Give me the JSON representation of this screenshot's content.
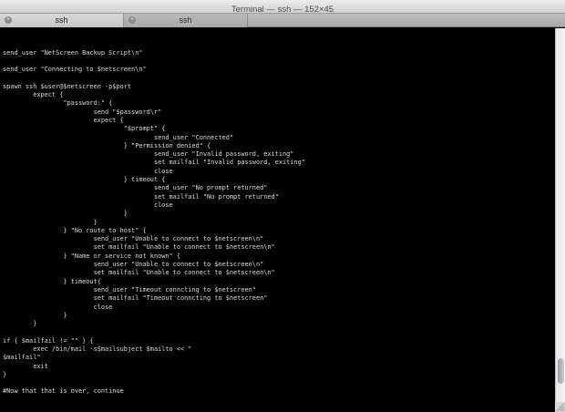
{
  "window": {
    "title": "Terminal — ssh — 152×45"
  },
  "tabs": [
    {
      "label": "ssh",
      "active": true
    },
    {
      "label": "ssh",
      "active": false
    }
  ],
  "terminal": {
    "lines": [
      "",
      "",
      "send_user \"NetScreen Backup Script\\n\"",
      "",
      "send_user \"Connecting to $netscreen\\n\"",
      "",
      "spawn ssh $user@$netscreen -p$port",
      "        expect {",
      "                \"password:\" {",
      "                        send \"$password\\r\"",
      "                        expect {",
      "                                \"$prompt\" {",
      "                                        send_user \"Connected\"",
      "                                } \"Permission denied\" {",
      "                                        send_user \"Invalid password, exiting\"",
      "                                        set mailfail \"Invalid password, exiting\"",
      "                                        close",
      "                                } timeout {",
      "                                        send_user \"No prompt returned\"",
      "                                        set mailfail \"No prompt returned\"",
      "                                        close",
      "                                }",
      "                        }",
      "                } \"No route to host\" {",
      "                        send_user \"Unable to connect to $netscreen\\n\"",
      "                        set mailfail \"Unable to connect to $netscreen\\n\"",
      "                } \"Name or service not known\" {",
      "                        send_user \"Unable to connect to $netscreen\\n\"",
      "                        set mailfail \"Unable to connect to $netscreen\\n\"",
      "                } timeout{",
      "                        send_user \"Timeout conncting to $netscreen\"",
      "                        set mailfail \"Timeout conncting to $netscreen\"",
      "                        close",
      "                }",
      "        }",
      "",
      "if { $mailfail != \"\" } {",
      "        exec /bin/mail -s$mailsubject $mailto << \"",
      "$mailfail\"",
      "        exit",
      "}",
      "",
      "#Now that that is over, continue",
      "",
      ""
    ]
  },
  "colors": {
    "background": "#000000",
    "text": "#d9d9d9"
  }
}
